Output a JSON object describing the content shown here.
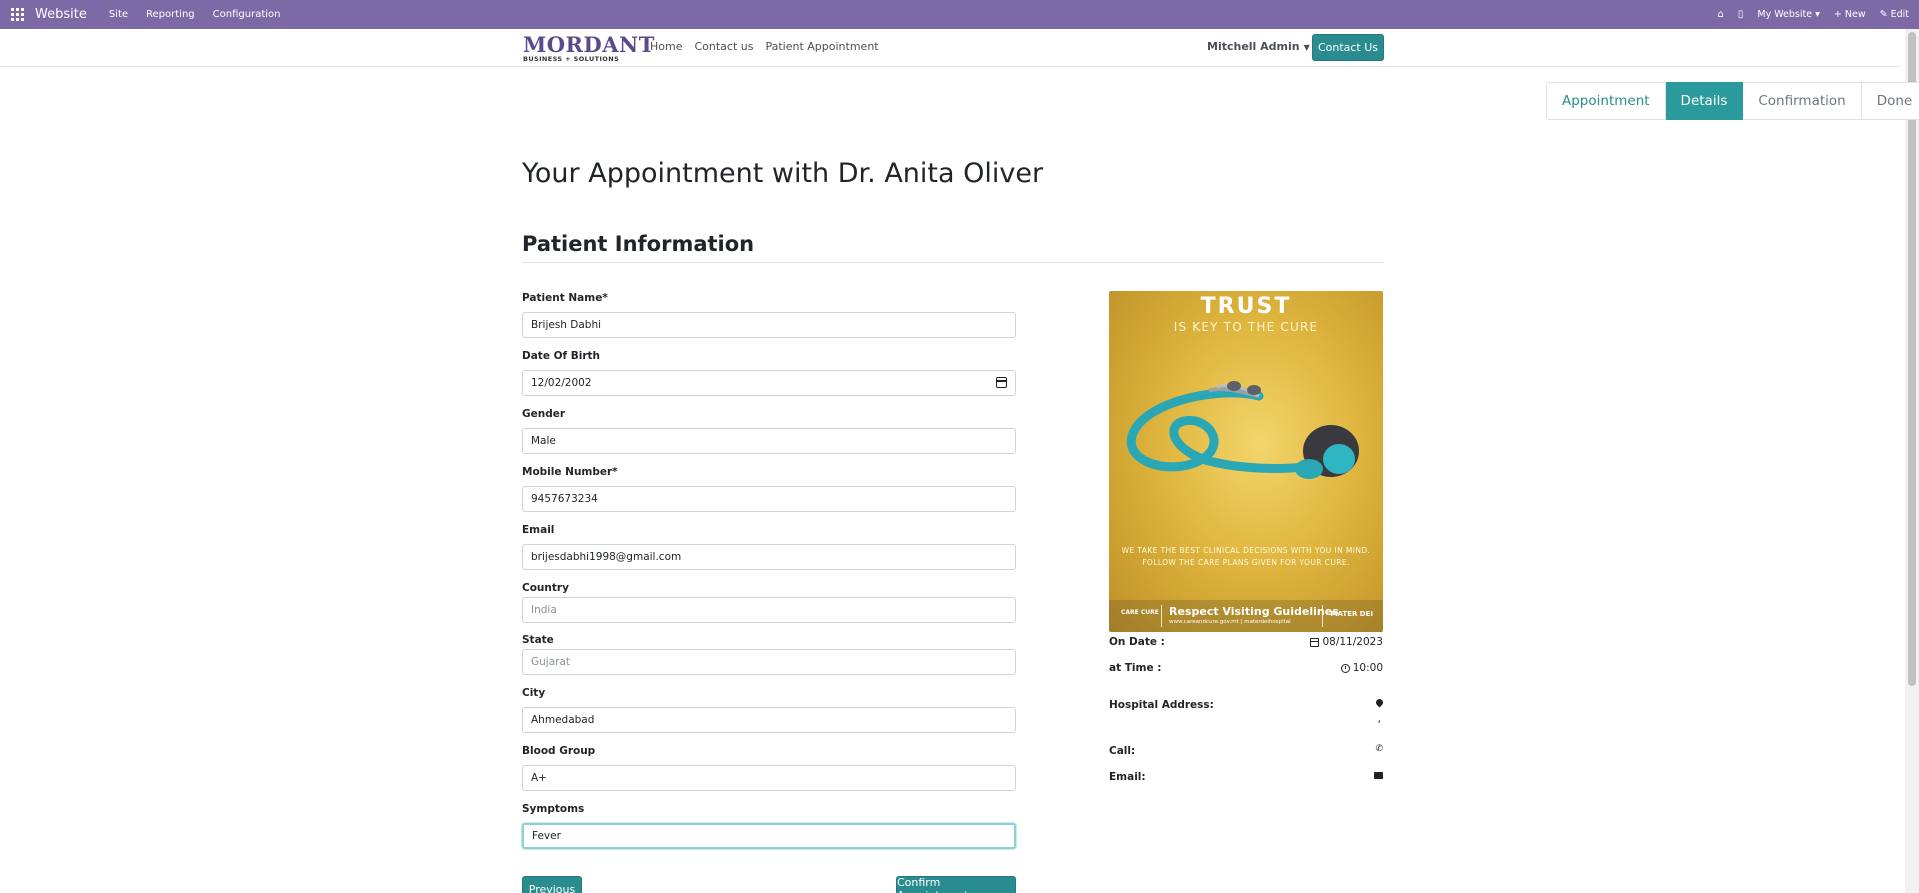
{
  "adminbar": {
    "brand": "Website",
    "menu": [
      "Site",
      "Reporting",
      "Configuration"
    ],
    "my_website": "My Website",
    "new": "New",
    "edit": "Edit"
  },
  "header": {
    "logo_main": "MORDANT",
    "logo_sub": "BUSINESS + SOLUTIONS",
    "nav": [
      "Home",
      "Contact us",
      "Patient Appointment"
    ],
    "user": "Mitchell Admin",
    "contact_button": "Contact Us"
  },
  "steps": [
    "Appointment",
    "Details",
    "Confirmation",
    "Done"
  ],
  "active_step": "Details",
  "page_title": "Your Appointment with Dr. Anita Oliver",
  "section_title": "Patient Information",
  "form": {
    "patient_name_label": "Patient Name*",
    "patient_name": "Brijesh Dabhi",
    "dob_label": "Date Of Birth",
    "dob": "12/02/2002",
    "gender_label": "Gender",
    "gender": "Male",
    "mobile_label": "Mobile Number*",
    "mobile": "9457673234",
    "email_label": "Email",
    "email": "brijesdabhi1998@gmail.com",
    "country_label": "Country",
    "country_placeholder": "India",
    "state_label": "State",
    "state_placeholder": "Gujarat",
    "city_label": "City",
    "city": "Ahmedabad",
    "blood_label": "Blood Group",
    "blood": "A+",
    "symptoms_label": "Symptoms",
    "symptoms": "Fever",
    "previous": "Previous",
    "confirm": "Confirm Appointment"
  },
  "poster": {
    "title": "TRUST",
    "subtitle": "IS KEY TO THE CURE",
    "message_1": "WE TAKE THE BEST CLINICAL DECISIONS WITH YOU IN MIND.",
    "message_2": "FOLLOW THE CARE PLANS GIVEN FOR YOUR CURE.",
    "footer_brand": "CARE CURE",
    "footer_title": "Respect Visiting Guidelines",
    "footer_links": "www.careandcure.gov.mt  |  materdeihospital",
    "footer_hospital": "MATER DEI"
  },
  "info": {
    "on_date_label": "On Date :",
    "on_date": "08/11/2023",
    "time_label": "at Time :",
    "time": "10:00",
    "address_label": "Hospital Address:",
    "address_value": ",",
    "call_label": "Call:",
    "email_label": "Email:"
  }
}
